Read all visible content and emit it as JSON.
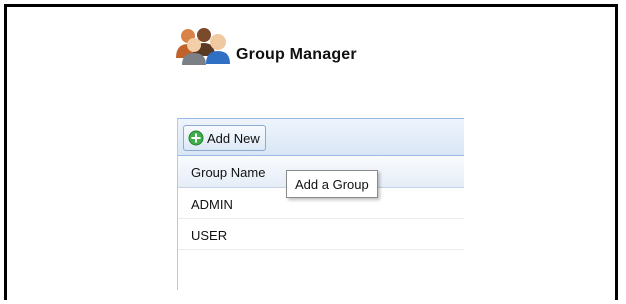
{
  "header": {
    "title": "Group Manager",
    "icon": "group-users-icon"
  },
  "toolbar": {
    "add_label": "Add New",
    "add_icon": "add-circle-icon",
    "accent": "#2e9e3a"
  },
  "grid": {
    "column_header": "Group Name",
    "rows": [
      {
        "name": "ADMIN"
      },
      {
        "name": "USER"
      }
    ]
  },
  "tooltip": {
    "text": "Add a Group"
  }
}
